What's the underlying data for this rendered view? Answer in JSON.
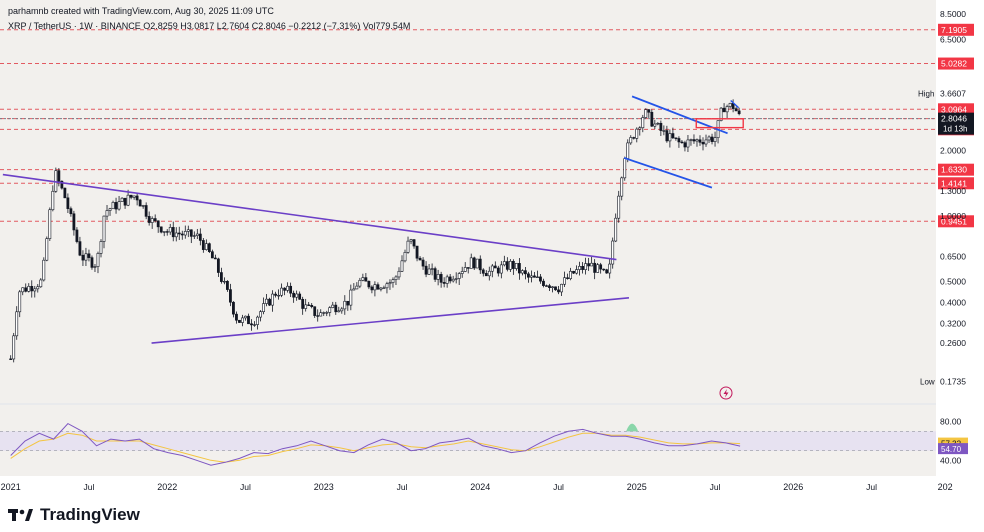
{
  "header": {
    "credit": "parhamnb created with TradingView.com, Aug 30, 2025 11:09 UTC",
    "symbol_line": "XRP / TetherUS · 1W · BINANCE  O2.8259  H3.0817  L2.7604  C2.8046 −0.2212 (−7.31%)  Vol779.54M"
  },
  "brand": {
    "name": "TradingView"
  },
  "colors": {
    "background": "#ffffff",
    "plot_background": "#f2f0ed",
    "candle": "#131722",
    "level_line": "#e25a61",
    "level_label_bg": "#f23645",
    "current_line": "#787b86",
    "current_label_bg": "#131722",
    "triangle_line": "#6b3fc7",
    "channel_line": "#2454e8",
    "rsi_line": "#7e57c2",
    "rsi_ma": "#f4c542",
    "rsi_fill": "#e3dcf2",
    "rsi_overbought_fill": "#6fcf97"
  },
  "chart_data": [
    {
      "type": "candlestick",
      "title": "XRP / TetherUS · 1W · BINANCE",
      "scale": "log",
      "ylim": [
        0.15,
        8.5
      ],
      "y_ticks": [
        8.5,
        6.5,
        3.6607,
        2.0,
        1.3,
        1.0,
        0.65,
        0.5,
        0.4,
        0.32,
        0.26,
        0.1735
      ],
      "y_tick_labels": [
        "8.5000",
        "6.5000",
        "3.6607",
        "2.0000",
        "1.3000",
        "1.0000",
        "0.6500",
        "0.5000",
        "0.4000",
        "0.3200",
        "0.2600",
        "0.1735"
      ],
      "x_labels": [
        "2021",
        "Jul",
        "2022",
        "Jul",
        "2023",
        "Jul",
        "2024",
        "Jul",
        "2025",
        "Jul",
        "2026",
        "Jul",
        "202"
      ],
      "last_ohlc": {
        "open": 2.8259,
        "high": 3.0817,
        "low": 2.7604,
        "close": 2.8046,
        "change": -0.2212,
        "change_pct": -7.31,
        "volume": "779.54M"
      },
      "countdown": "1d 13h",
      "markers": [
        {
          "label": "High",
          "value": 3.6607
        },
        {
          "label": "Low",
          "value": 0.1735
        }
      ],
      "levels": [
        {
          "value": 7.1905,
          "label": "7.1905"
        },
        {
          "value": 5.0282,
          "label": "5.0282"
        },
        {
          "value": 3.0964,
          "label": "3.0964"
        },
        {
          "value": 2.8052,
          "label": "2.8052"
        },
        {
          "value": 2.5045,
          "label": "2.5045"
        },
        {
          "value": 1.633,
          "label": "1.6330"
        },
        {
          "value": 1.4141,
          "label": "1.4141"
        },
        {
          "value": 0.9451,
          "label": "0.9451"
        }
      ],
      "current_price": {
        "value": 2.8046,
        "label": "2.8046"
      },
      "anchors": [
        [
          2021.0,
          0.22
        ],
        [
          2021.05,
          0.45
        ],
        [
          2021.2,
          0.5
        ],
        [
          2021.28,
          1.6
        ],
        [
          2021.35,
          1.2
        ],
        [
          2021.45,
          0.65
        ],
        [
          2021.55,
          0.6
        ],
        [
          2021.6,
          1.05
        ],
        [
          2021.7,
          1.15
        ],
        [
          2021.8,
          1.25
        ],
        [
          2021.9,
          0.95
        ],
        [
          2022.0,
          0.85
        ],
        [
          2022.2,
          0.8
        ],
        [
          2022.3,
          0.62
        ],
        [
          2022.38,
          0.45
        ],
        [
          2022.45,
          0.33
        ],
        [
          2022.55,
          0.33
        ],
        [
          2022.7,
          0.45
        ],
        [
          2022.8,
          0.45
        ],
        [
          2022.88,
          0.38
        ],
        [
          2022.97,
          0.35
        ],
        [
          2023.05,
          0.38
        ],
        [
          2023.15,
          0.4
        ],
        [
          2023.22,
          0.5
        ],
        [
          2023.32,
          0.48
        ],
        [
          2023.45,
          0.5
        ],
        [
          2023.55,
          0.78
        ],
        [
          2023.62,
          0.6
        ],
        [
          2023.75,
          0.5
        ],
        [
          2023.85,
          0.55
        ],
        [
          2023.95,
          0.62
        ],
        [
          2024.05,
          0.55
        ],
        [
          2024.2,
          0.6
        ],
        [
          2024.3,
          0.52
        ],
        [
          2024.4,
          0.5
        ],
        [
          2024.5,
          0.47
        ],
        [
          2024.6,
          0.55
        ],
        [
          2024.7,
          0.6
        ],
        [
          2024.77,
          0.55
        ],
        [
          2024.82,
          0.52
        ],
        [
          2024.87,
          1.1
        ],
        [
          2024.92,
          1.9
        ],
        [
          2024.97,
          2.3
        ],
        [
          2025.05,
          3.0
        ],
        [
          2025.12,
          2.6
        ],
        [
          2025.2,
          2.3
        ],
        [
          2025.28,
          2.15
        ],
        [
          2025.35,
          2.2
        ],
        [
          2025.42,
          2.25
        ],
        [
          2025.5,
          2.3
        ],
        [
          2025.55,
          3.2
        ],
        [
          2025.62,
          3.2
        ],
        [
          2025.66,
          2.8046
        ]
      ],
      "triangle": {
        "upper": [
          [
            2020.95,
            1.55
          ],
          [
            2024.87,
            0.63
          ]
        ],
        "lower": [
          [
            2021.9,
            0.26
          ],
          [
            2024.95,
            0.42
          ]
        ]
      },
      "channel": {
        "upper": [
          [
            2024.97,
            3.55
          ],
          [
            2025.58,
            2.4
          ]
        ],
        "lower": [
          [
            2024.92,
            1.85
          ],
          [
            2025.48,
            1.35
          ]
        ]
      },
      "breakout_box": {
        "x": [
          2025.38,
          2025.68
        ],
        "y": [
          2.55,
          2.8
        ]
      },
      "pattern_marks": [
        {
          "x": 2025.6,
          "y": 3.4
        },
        {
          "x": 2025.65,
          "y": 3.15
        }
      ]
    },
    {
      "type": "line",
      "title": "RSI",
      "ylim": [
        30,
        90
      ],
      "y_ticks": [
        80,
        40
      ],
      "y_tick_labels": [
        "80.00",
        "40.00"
      ],
      "bands": {
        "upper": 70,
        "lower": 50
      },
      "rsi_value": 54.7,
      "rsi_ma_value": 57.32,
      "value_labels": [
        "57.32",
        "54.70"
      ],
      "series": [
        {
          "name": "RSI",
          "values": [
            45,
            60,
            68,
            62,
            78,
            70,
            55,
            62,
            60,
            62,
            52,
            48,
            45,
            40,
            35,
            38,
            42,
            48,
            47,
            52,
            55,
            60,
            55,
            50,
            48,
            56,
            62,
            58,
            50,
            52,
            58,
            60,
            63,
            55,
            52,
            48,
            50,
            58,
            65,
            70,
            72,
            68,
            65,
            65,
            62,
            58,
            55,
            55,
            57,
            60,
            58,
            54.7
          ]
        },
        {
          "name": "RSI-based MA",
          "values": [
            42,
            52,
            60,
            62,
            68,
            66,
            60,
            60,
            60,
            60,
            56,
            52,
            48,
            44,
            40,
            38,
            40,
            44,
            45,
            49,
            52,
            56,
            55,
            53,
            50,
            53,
            56,
            57,
            54,
            53,
            55,
            57,
            60,
            57,
            54,
            51,
            50,
            54,
            59,
            64,
            68,
            68,
            66,
            66,
            64,
            61,
            58,
            57,
            57,
            58,
            58,
            57.32
          ]
        }
      ]
    }
  ]
}
